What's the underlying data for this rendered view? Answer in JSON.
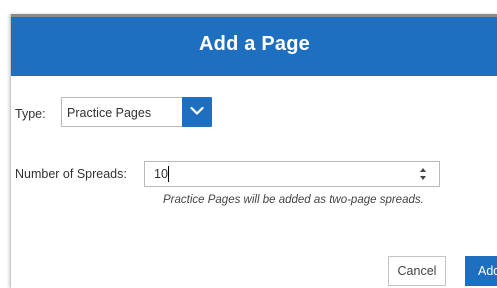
{
  "dialog": {
    "title": "Add a Page"
  },
  "type_field": {
    "label": "Type:",
    "selected": "Practice Pages",
    "icon": "chevron-down-icon"
  },
  "spreads_field": {
    "label": "Number of Spreads:",
    "value": "10",
    "hint": "Practice Pages will be added as two-page spreads.",
    "icon": "spinner-arrows-icon"
  },
  "buttons": {
    "cancel": "Cancel",
    "add": "Add"
  },
  "colors": {
    "accent": "#1f6fc0",
    "header_text": "#ffffff"
  }
}
